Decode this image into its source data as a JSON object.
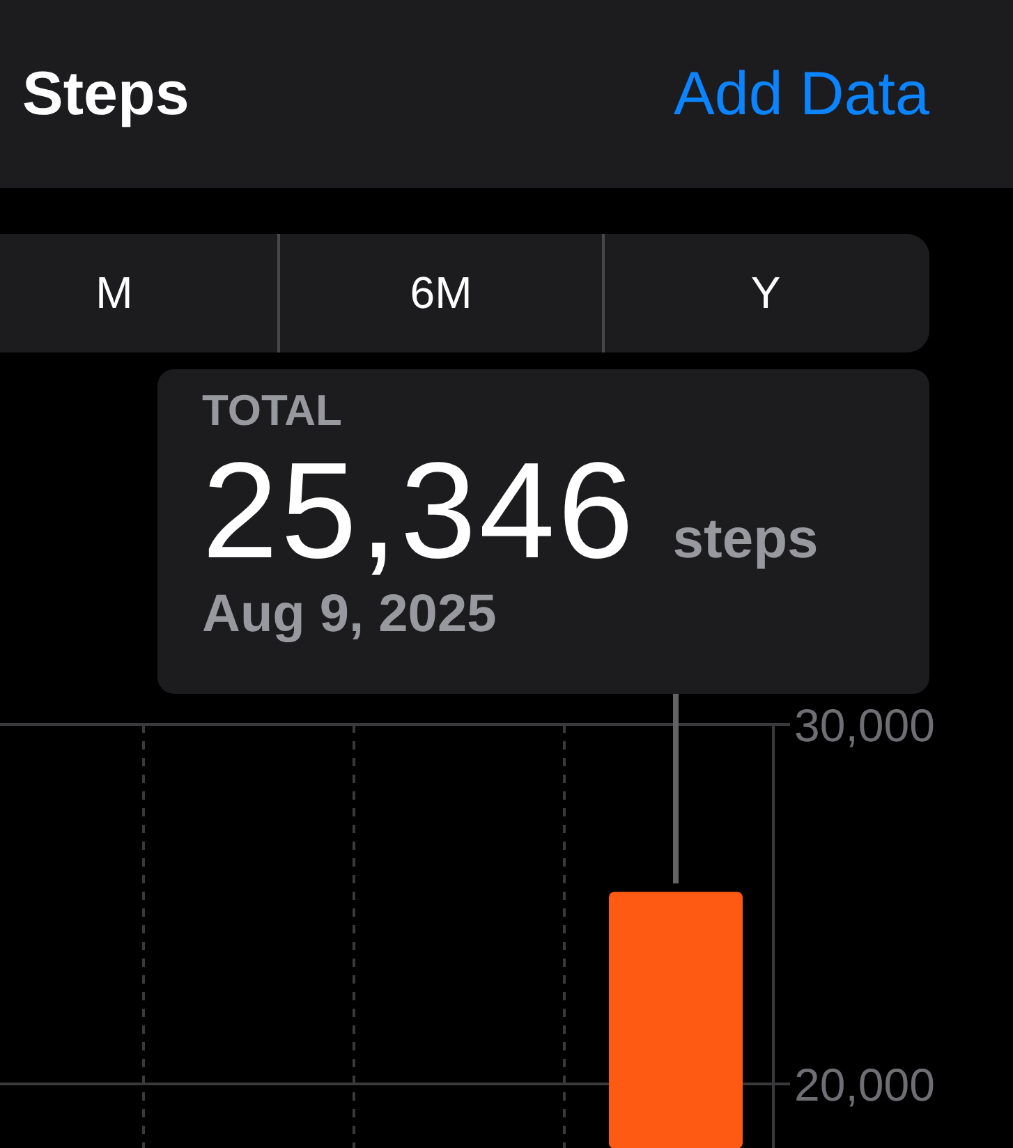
{
  "header": {
    "title": "Steps",
    "action": "Add Data"
  },
  "ranges": [
    {
      "label": "M",
      "selected": false
    },
    {
      "label": "6M",
      "selected": false
    },
    {
      "label": "Y",
      "selected": false
    }
  ],
  "summary": {
    "label": "TOTAL",
    "value": "25,346",
    "unit": "steps",
    "date": "Aug 9, 2025"
  },
  "chart": {
    "chart_data": {
      "type": "bar",
      "values": [
        25346
      ],
      "ylim": [
        18200,
        30000
      ],
      "yticks": [
        {
          "value": 30000,
          "label": "30,000"
        },
        {
          "value": 20000,
          "label": "20,000"
        }
      ]
    }
  }
}
